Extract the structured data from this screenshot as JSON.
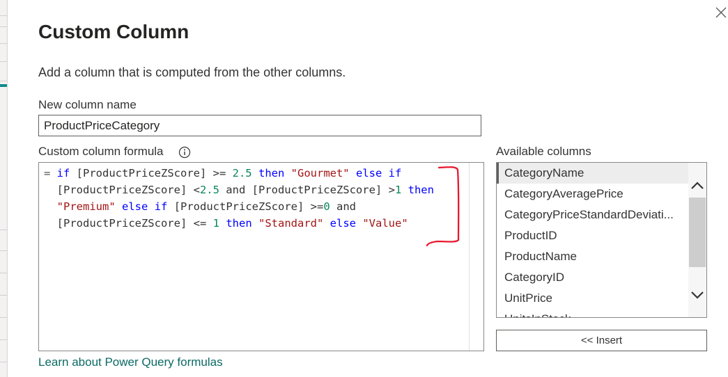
{
  "dialog": {
    "title": "Custom Column",
    "description": "Add a column that is computed from the other columns."
  },
  "new_column": {
    "label": "New column name",
    "value": "ProductPriceCategory"
  },
  "formula": {
    "label": "Custom column formula",
    "info_icon": "info-icon",
    "lines": [
      [
        {
          "t": "= ",
          "c": "eq"
        },
        {
          "t": "if",
          "c": "kw"
        },
        {
          "t": " [ProductPriceZScore] >= ",
          "c": ""
        },
        {
          "t": "2.5",
          "c": "num"
        },
        {
          "t": " ",
          "c": ""
        },
        {
          "t": "then",
          "c": "kw"
        },
        {
          "t": " ",
          "c": ""
        },
        {
          "t": "\"Gourmet\"",
          "c": "str"
        },
        {
          "t": " ",
          "c": ""
        },
        {
          "t": "else",
          "c": "kw"
        },
        {
          "t": " ",
          "c": ""
        },
        {
          "t": "if",
          "c": "kw"
        }
      ],
      [
        {
          "t": "  [ProductPriceZScore] <",
          "c": ""
        },
        {
          "t": "2.5",
          "c": "num"
        },
        {
          "t": " and [ProductPriceZScore] >",
          "c": ""
        },
        {
          "t": "1",
          "c": "num"
        },
        {
          "t": " ",
          "c": ""
        },
        {
          "t": "then",
          "c": "kw"
        }
      ],
      [
        {
          "t": "  ",
          "c": ""
        },
        {
          "t": "\"Premium\"",
          "c": "str"
        },
        {
          "t": " ",
          "c": ""
        },
        {
          "t": "else",
          "c": "kw"
        },
        {
          "t": " ",
          "c": ""
        },
        {
          "t": "if",
          "c": "kw"
        },
        {
          "t": " [ProductPriceZScore] >=",
          "c": ""
        },
        {
          "t": "0",
          "c": "num"
        },
        {
          "t": " and",
          "c": ""
        }
      ],
      [
        {
          "t": "  [ProductPriceZScore] <= ",
          "c": ""
        },
        {
          "t": "1",
          "c": "num"
        },
        {
          "t": " ",
          "c": ""
        },
        {
          "t": "then",
          "c": "kw"
        },
        {
          "t": " ",
          "c": ""
        },
        {
          "t": "\"Standard\"",
          "c": "str"
        },
        {
          "t": " ",
          "c": ""
        },
        {
          "t": "else",
          "c": "kw"
        },
        {
          "t": " ",
          "c": ""
        },
        {
          "t": "\"Value\"",
          "c": "str"
        }
      ]
    ]
  },
  "available_columns": {
    "label": "Available columns",
    "selected": "CategoryName",
    "items": [
      "CategoryName",
      "CategoryAveragePrice",
      "CategoryPriceStandardDeviati...",
      "ProductID",
      "ProductName",
      "CategoryID",
      "UnitPrice",
      "UnitsInStock"
    ],
    "insert_label": "<< Insert"
  },
  "footer": {
    "learn_link": "Learn about Power Query formulas"
  },
  "colors": {
    "keyword": "#0000ff",
    "number": "#098658",
    "string": "#a31515",
    "link": "#0b6a64",
    "annotation": "#e8182e"
  }
}
